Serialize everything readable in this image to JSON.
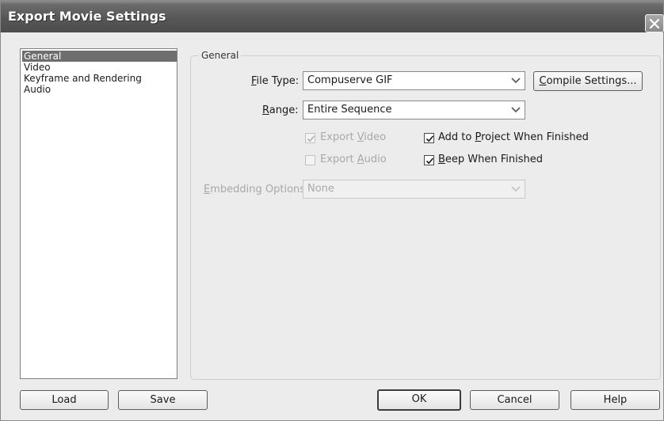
{
  "window": {
    "title": "Export Movie Settings"
  },
  "sidebar": {
    "items": [
      {
        "label": "General",
        "selected": true
      },
      {
        "label": "Video",
        "selected": false
      },
      {
        "label": "Keyframe and Rendering",
        "selected": false
      },
      {
        "label": "Audio",
        "selected": false
      }
    ]
  },
  "general": {
    "group_title": "General",
    "file_type": {
      "label_prefix": "",
      "label_mnemonic": "F",
      "label_rest": "ile Type:",
      "value": "Compuserve GIF"
    },
    "compile_settings": {
      "mnemonic": "C",
      "rest": "ompile Settings..."
    },
    "range": {
      "label_mnemonic": "R",
      "label_rest": "ange:",
      "value": "Entire Sequence"
    },
    "export_video": {
      "prefix": "Export ",
      "mnemonic": "V",
      "rest": "ideo",
      "checked": true,
      "enabled": false
    },
    "export_audio": {
      "prefix": "Export ",
      "mnemonic": "A",
      "rest": "udio",
      "checked": false,
      "enabled": false
    },
    "add_to_project": {
      "prefix": "Add to ",
      "mnemonic": "P",
      "rest": "roject When Finished",
      "checked": true,
      "enabled": true
    },
    "beep_when_finished": {
      "prefix": "",
      "mnemonic": "B",
      "rest": "eep When Finished",
      "checked": true,
      "enabled": true
    },
    "embedding": {
      "label_mnemonic": "E",
      "label_rest": "mbedding Options:",
      "value": "None",
      "enabled": false
    }
  },
  "buttons": {
    "load": "Load",
    "save": "Save",
    "ok": "OK",
    "cancel": "Cancel",
    "help": "Help"
  }
}
